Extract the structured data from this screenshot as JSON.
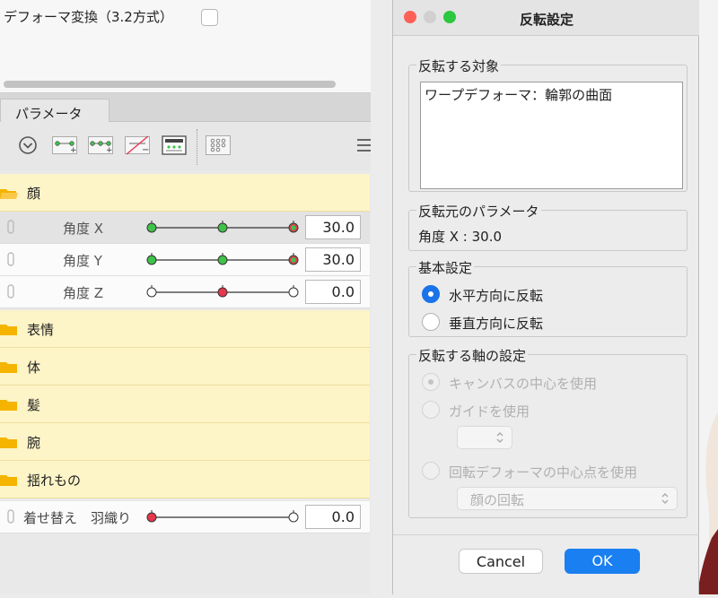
{
  "top_panel": {
    "label": "デフォーマ変換（3.2方式）"
  },
  "tabs": [
    {
      "label": "パラメータ"
    }
  ],
  "toolbar": {
    "icons": [
      "chevron-circle-icon",
      "add-keyform-2-icon",
      "add-keyform-3-icon",
      "delete-keyform-icon",
      "keyform-panel-icon",
      "grid-dots-icon",
      "menu-icon"
    ]
  },
  "params": {
    "groups": [
      {
        "label": "顔"
      },
      {
        "label": "表情"
      },
      {
        "label": "体"
      },
      {
        "label": "髪"
      },
      {
        "label": "腕"
      },
      {
        "label": "揺れもの"
      }
    ],
    "rows": [
      {
        "label": "角度 X",
        "value": "30.0"
      },
      {
        "label": "角度 Y",
        "value": "30.0"
      },
      {
        "label": "角度 Z",
        "value": "0.0"
      },
      {
        "label": "着せ替え　羽織り",
        "value": "0.0"
      }
    ],
    "colors": {
      "group_bg": "#fdf4c7",
      "active_knot": "#e8364d",
      "keyform_knot": "#3fc24a"
    }
  },
  "dialog": {
    "title": "反転設定",
    "target_section": {
      "legend": "反転する対象",
      "item": "ワープデフォーマ：輪郭の曲面"
    },
    "source_section": {
      "legend": "反転元のパラメータ",
      "text": "角度 X : 30.0"
    },
    "basic_section": {
      "legend": "基本設定",
      "options": [
        "水平方向に反転",
        "垂直方向に反転"
      ],
      "selected": 0
    },
    "axis_section": {
      "legend": "反転する軸の設定",
      "options": [
        "キャンバスの中心を使用",
        "ガイドを使用",
        "回転デフォーマの中心点を使用"
      ],
      "guide_select_value": "",
      "rotation_select_value": "顔の回転"
    },
    "buttons": {
      "cancel": "Cancel",
      "ok": "OK"
    },
    "accent": "#1a7ff0"
  }
}
